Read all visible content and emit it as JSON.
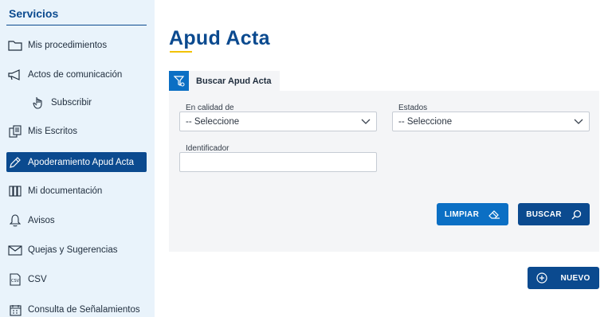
{
  "sidebar": {
    "title": "Servicios",
    "items": [
      {
        "label": "Mis procedimientos",
        "icon": "folder-icon"
      },
      {
        "label": "Actos de comunicación",
        "icon": "megaphone-icon"
      },
      {
        "label": "Subscribir",
        "icon": "hand-pointer-icon"
      },
      {
        "label": "Mis Escritos",
        "icon": "documents-icon"
      },
      {
        "label": "Apoderamiento Apud Acta",
        "icon": "pen-icon",
        "active": true
      },
      {
        "label": "Mi documentación",
        "icon": "binders-icon"
      },
      {
        "label": "Avisos",
        "icon": "bell-icon"
      },
      {
        "label": "Quejas y Sugerencias",
        "icon": "envelope-icon"
      },
      {
        "label": "CSV",
        "icon": "csv-file-icon"
      },
      {
        "label": "Consulta de Señalamientos",
        "icon": "calendar-icon"
      }
    ]
  },
  "main": {
    "title": "Apud Acta",
    "tab": {
      "label": "Buscar Apud Acta",
      "icon": "filter-icon"
    },
    "form": {
      "calidad": {
        "label": "En calidad de",
        "value": "-- Seleccione"
      },
      "estados": {
        "label": "Estados",
        "value": "-- Seleccione"
      },
      "identificador": {
        "label": "Identificador",
        "value": ""
      }
    },
    "buttons": {
      "limpiar": "LIMPIAR",
      "buscar": "BUSCAR",
      "nuevo": "NUEVO"
    }
  },
  "colors": {
    "sidebar_bg": "#e9f3fb",
    "primary": "#0b4a8f",
    "accent": "#0b6fc4",
    "title_underline": "#f2c200",
    "panel_bg": "#f4f5f7"
  }
}
